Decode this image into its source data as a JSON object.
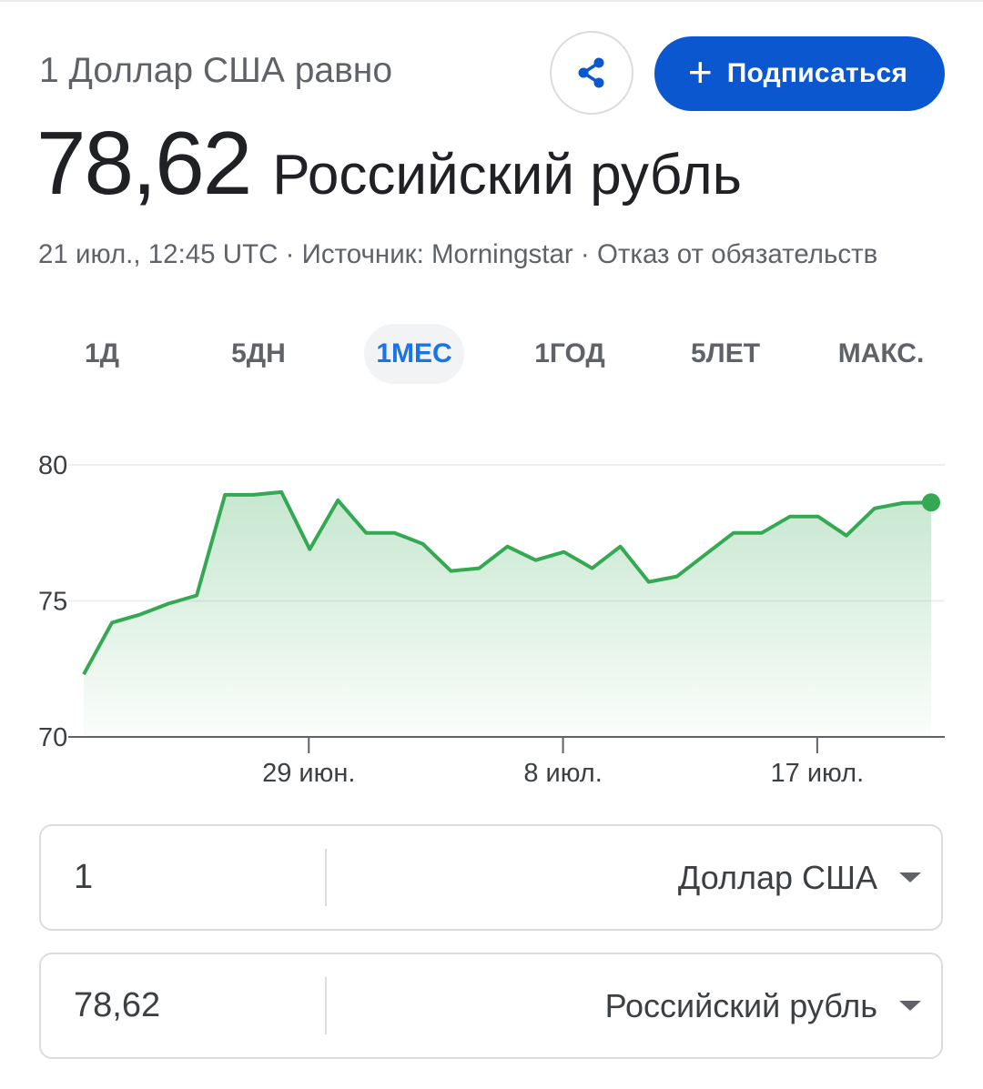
{
  "header": {
    "subtitle": "1 Доллар США равно",
    "share_icon": "share-icon",
    "subscribe": {
      "icon": "plus-icon",
      "label": "Подписаться"
    }
  },
  "rate": {
    "value": "78,62",
    "currency": "Российский рубль"
  },
  "meta": {
    "timestamp": "21 июл., 12:45 UTC",
    "sep1": " · ",
    "source": "Источник: Morningstar",
    "sep2": " · ",
    "disclaimer": "Отказ от обязательств"
  },
  "tabs": [
    {
      "label": "1Д",
      "active": false
    },
    {
      "label": "5ДН",
      "active": false
    },
    {
      "label": "1МЕС",
      "active": true
    },
    {
      "label": "1ГОД",
      "active": false
    },
    {
      "label": "5ЛЕТ",
      "active": false
    },
    {
      "label": "МАКС.",
      "active": false
    }
  ],
  "colors": {
    "accent": "#0b57d0",
    "active_tab": "#1a73e8",
    "line": "#34a853"
  },
  "chart_data": {
    "type": "area",
    "title": "",
    "xlabel": "",
    "ylabel": "",
    "ylim": [
      70,
      80
    ],
    "y_ticks": [
      "80",
      "75",
      "70"
    ],
    "x_tick_labels": [
      "29 июн.",
      "8 июл.",
      "17 июл."
    ],
    "grid": true,
    "legend": "none",
    "series": [
      {
        "values": [
          72.3,
          74.2,
          74.5,
          74.9,
          75.2,
          78.9,
          78.9,
          79.0,
          76.9,
          78.7,
          77.5,
          77.5,
          77.1,
          76.1,
          76.2,
          77.0,
          76.5,
          76.8,
          76.2,
          77.0,
          75.7,
          75.9,
          76.7,
          77.5,
          77.5,
          78.1,
          78.1,
          77.4,
          78.4,
          78.6,
          78.62
        ]
      }
    ]
  },
  "converter": {
    "from": {
      "value": "1",
      "currency": "Доллар США"
    },
    "to": {
      "value": "78,62",
      "currency": "Российский рубль"
    }
  }
}
